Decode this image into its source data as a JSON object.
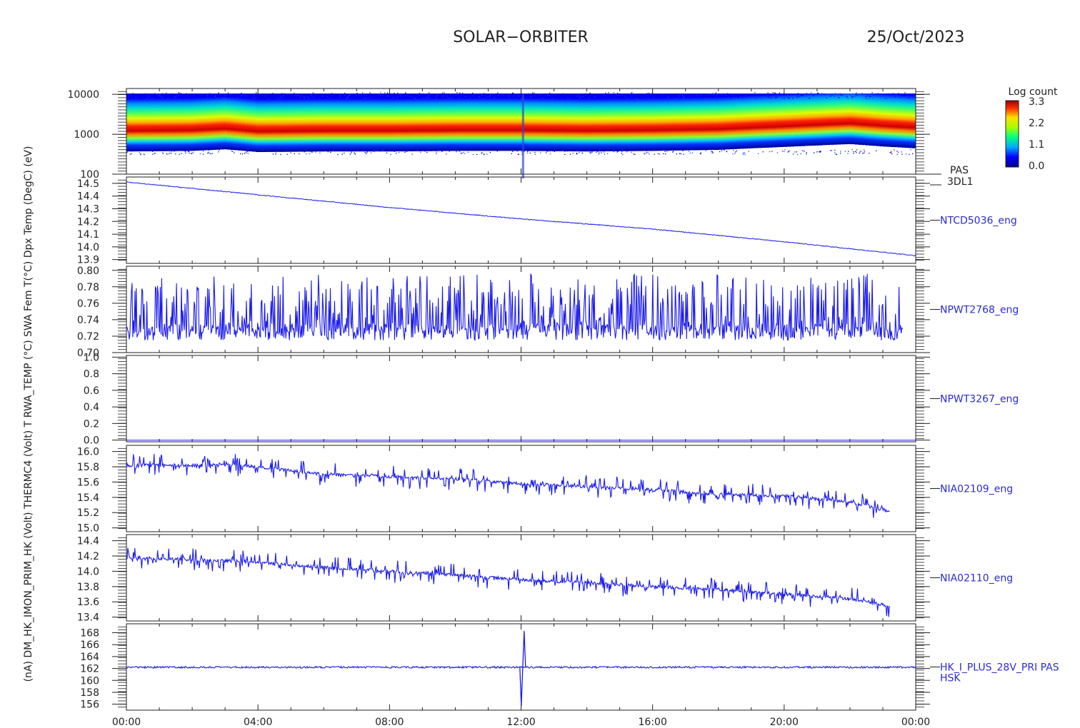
{
  "header": {
    "mission": "SOLAR−ORBITER",
    "date": "25/Oct/2023"
  },
  "y_axis_title": "(nA) DM_HK_IMON_PRIM_HK (Volt) THERMC4 (Volt) T RWA_TEMP (°C) SWA Fem T(°C) Dpx Temp (DegC) (eV)",
  "colorbar": {
    "title": "Log count",
    "ticks": [
      "3.3",
      "2.2",
      "1.1",
      "0.0"
    ]
  },
  "colors": {
    "trace": "#1a1aee",
    "label": "#2b2bd0",
    "axis": "#222222"
  },
  "chart_data": [
    {
      "type": "heatmap",
      "label": "PAS",
      "sublabel": "3DL1",
      "ylabel": "(eV)",
      "yscale": "log",
      "ylim": [
        100,
        14000
      ],
      "yticks": [
        "10000",
        "1000",
        "100"
      ],
      "colormap": "rainbow (blue to red)",
      "peak_energy_eV": [
        [
          0,
          1500
        ],
        [
          2,
          1550
        ],
        [
          3,
          1700
        ],
        [
          4,
          1450
        ],
        [
          6,
          1500
        ],
        [
          8,
          1500
        ],
        [
          10,
          1550
        ],
        [
          12,
          1550
        ],
        [
          14,
          1500
        ],
        [
          16,
          1550
        ],
        [
          18,
          1650
        ],
        [
          20,
          1950
        ],
        [
          22,
          2300
        ],
        [
          23,
          2000
        ],
        [
          24,
          1800
        ]
      ]
    },
    {
      "type": "line",
      "label": "NTCD5036_eng",
      "ylim": [
        13.87,
        14.55
      ],
      "yticks": [
        "14.5",
        "14.4",
        "14.3",
        "14.2",
        "14.1",
        "14.0",
        "13.9"
      ],
      "x": [
        0,
        4,
        8,
        12,
        16,
        20,
        24
      ],
      "y": [
        14.51,
        14.41,
        14.31,
        14.22,
        14.14,
        14.04,
        13.93
      ]
    },
    {
      "type": "line",
      "label": "NPWT2768_eng",
      "ylim": [
        0.7,
        0.805
      ],
      "yticks": [
        "0.80",
        "0.78",
        "0.76",
        "0.74",
        "0.72",
        "0.70"
      ],
      "baseline": 0.725,
      "range": [
        0.712,
        0.796
      ]
    },
    {
      "type": "line",
      "label": "NPWT3267_eng",
      "ylim": [
        -0.02,
        1.02
      ],
      "yticks": [
        "1.0",
        "0.8",
        "0.6",
        "0.4",
        "0.2",
        "0.0"
      ],
      "x": [
        0,
        24
      ],
      "y": [
        0.0,
        0.0
      ]
    },
    {
      "type": "line",
      "label": "NIA02109_eng",
      "ylim": [
        14.95,
        16.08
      ],
      "yticks": [
        "16.0",
        "15.8",
        "15.6",
        "15.4",
        "15.2",
        "15.0"
      ],
      "x": [
        0,
        3.5,
        6,
        10,
        12,
        14,
        16,
        18,
        20,
        22,
        23.2
      ],
      "y": [
        15.82,
        15.82,
        15.7,
        15.64,
        15.58,
        15.54,
        15.5,
        15.44,
        15.42,
        15.34,
        15.22
      ]
    },
    {
      "type": "line",
      "label": "NIA02110_eng",
      "ylim": [
        13.35,
        14.48
      ],
      "yticks": [
        "14.4",
        "14.2",
        "14.0",
        "13.8",
        "13.6",
        "13.4"
      ],
      "x": [
        0,
        3.5,
        6,
        8,
        10,
        12,
        14,
        16,
        18,
        20,
        22,
        23.2
      ],
      "y": [
        14.18,
        14.13,
        14.05,
        14.0,
        13.95,
        13.89,
        13.85,
        13.8,
        13.76,
        13.7,
        13.64,
        13.55
      ]
    },
    {
      "type": "line",
      "label": "HK_I_PLUS_28V_PRI PAS",
      "sublabel": "HSK",
      "ylim": [
        155,
        169.5
      ],
      "yticks": [
        "168",
        "166",
        "164",
        "162",
        "160",
        "158",
        "156"
      ],
      "baseline": 162.2,
      "spike": {
        "x": 12.05,
        "min": 155.7,
        "max": 168.3
      }
    }
  ],
  "x_axis": {
    "xlim": [
      0,
      24
    ],
    "ticks": [
      "00:00",
      "04:00",
      "08:00",
      "12:00",
      "16:00",
      "20:00",
      "00:00"
    ]
  }
}
